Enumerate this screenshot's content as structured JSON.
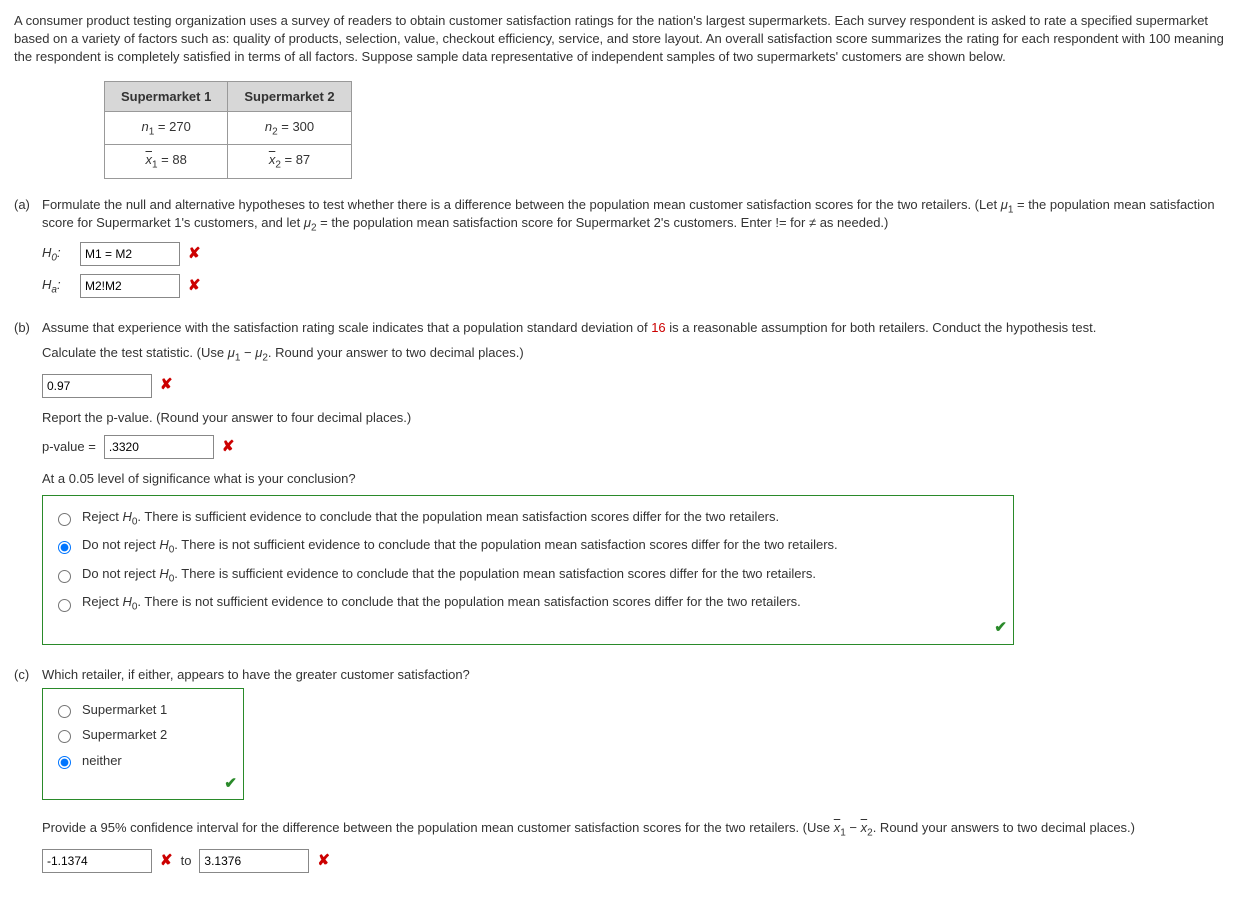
{
  "intro": "A consumer product testing organization uses a survey of readers to obtain customer satisfaction ratings for the nation's largest supermarkets. Each survey respondent is asked to rate a specified supermarket based on a variety of factors such as: quality of products, selection, value, checkout efficiency, service, and store layout. An overall satisfaction score summarizes the rating for each respondent with 100 meaning the respondent is completely satisfied in terms of all factors. Suppose sample data representative of independent samples of two supermarkets' customers are shown below.",
  "table": {
    "h1": "Supermarket 1",
    "h2": "Supermarket 2",
    "n1": "270",
    "n2": "300",
    "x1": "88",
    "x2": "87"
  },
  "a": {
    "label": "(a)",
    "text1": "Formulate the null and alternative hypotheses to test whether there is a difference between the population mean customer satisfaction scores for the two retailers. (Let ",
    "mu1def": " = the population mean satisfaction score for Supermarket 1's customers, and let ",
    "mu2def": " = the population mean satisfaction score for Supermarket 2's customers. Enter != for ≠ as needed.)",
    "h0label": "H0:",
    "halabel": "Ha:",
    "h0val": "M1 = M2",
    "haval": "M2!M2"
  },
  "b": {
    "label": "(b)",
    "text1a": "Assume that experience with the satisfaction rating scale indicates that a population standard deviation of ",
    "sigma": "16",
    "text1b": " is a reasonable assumption for both retailers. Conduct the hypothesis test.",
    "text2": "Calculate the test statistic. (Use μ1 − μ2. Round your answer to two decimal places.)",
    "tsval": "0.97",
    "text3": "Report the p-value. (Round your answer to four decimal places.)",
    "plabel": "p-value = ",
    "pval": ".3320",
    "text4": "At a 0.05 level of significance what is your conclusion?",
    "choices": [
      "Reject H0. There is sufficient evidence to conclude that the population mean satisfaction scores differ for the two retailers.",
      "Do not reject H0. There is not sufficient evidence to conclude that the population mean satisfaction scores differ for the two retailers.",
      "Do not reject H0. There is sufficient evidence to conclude that the population mean satisfaction scores differ for the two retailers.",
      "Reject H0. There is not sufficient evidence to conclude that the population mean satisfaction scores differ for the two retailers."
    ]
  },
  "c": {
    "label": "(c)",
    "text1": "Which retailer, if either, appears to have the greater customer satisfaction?",
    "choices": [
      "Supermarket 1",
      "Supermarket 2",
      "neither"
    ],
    "text2a": "Provide a 95% confidence interval for the difference between the population mean customer satisfaction scores for the two retailers. (Use ",
    "text2b": ". Round your answers to two decimal places.)",
    "low": "-1.1374",
    "to": "to",
    "high": "3.1376"
  },
  "marks": {
    "x": "✘",
    "check": "✔"
  }
}
